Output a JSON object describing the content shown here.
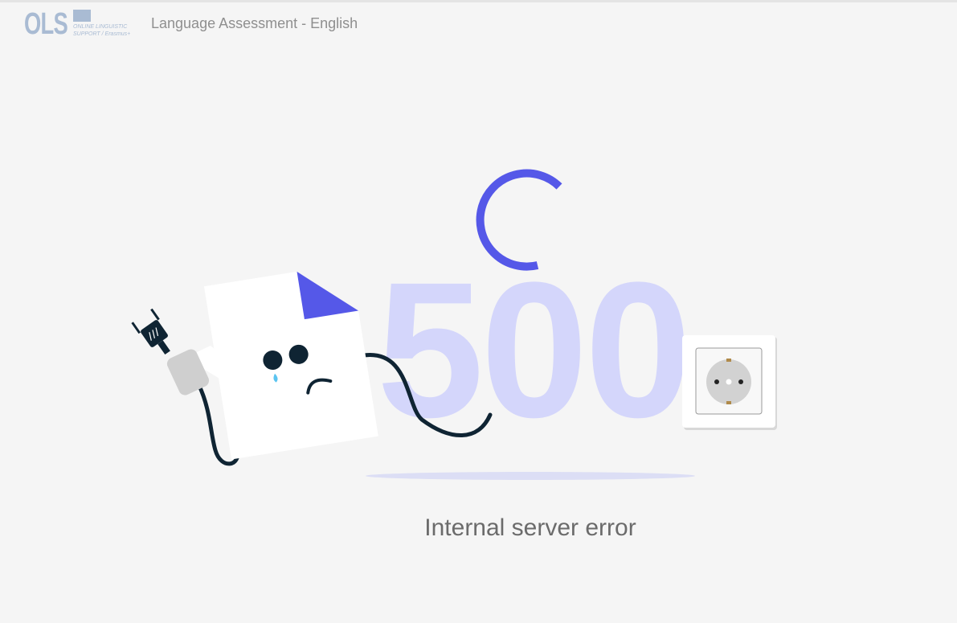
{
  "header": {
    "logo": {
      "letters": "OLS",
      "subtitle_line1": "ONLINE LINGUISTIC",
      "subtitle_line2": "SUPPORT / Erasmus+"
    },
    "title": "Language Assessment - English"
  },
  "error": {
    "code": "500",
    "message": "Internal server error",
    "icons": [
      "broken-document-icon",
      "unplugged-cable-icon",
      "power-plug-icon",
      "wall-socket-icon",
      "loading-arc-icon"
    ]
  },
  "colors": {
    "background": "#f5f5f5",
    "accent": "#5558e8",
    "code_fill": "#d4d6fb",
    "logo": "#a9bbd3",
    "cable": "#0f2433",
    "tear": "#5bc4f0"
  }
}
